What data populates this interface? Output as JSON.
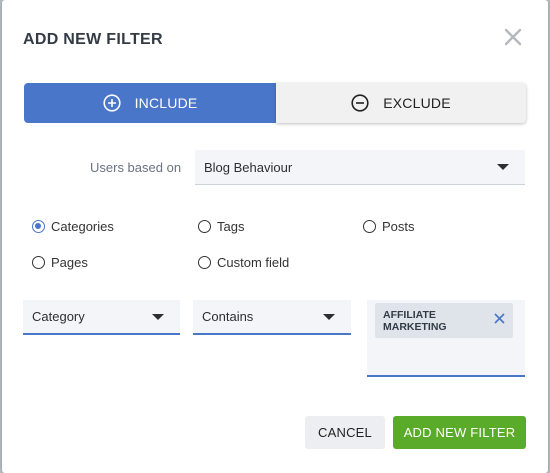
{
  "dialog": {
    "title": "ADD NEW FILTER"
  },
  "mode_toggle": {
    "include_label": "INCLUDE",
    "exclude_label": "EXCLUDE",
    "selected": "include",
    "accent_color": "#4a76c9"
  },
  "users_based_on": {
    "label": "Users based on",
    "value": "Blog Behaviour"
  },
  "filter_type": {
    "options": [
      "Categories",
      "Tags",
      "Posts",
      "Pages",
      "Custom field"
    ],
    "selected": "Categories"
  },
  "condition": {
    "field": "Category",
    "operator": "Contains",
    "values": [
      "AFFILIATE MARKETING"
    ]
  },
  "footer": {
    "cancel_label": "CANCEL",
    "add_label": "ADD NEW FILTER",
    "add_color": "#5bab2a"
  },
  "icons": {
    "close": "close-icon",
    "include": "plus-circle-icon",
    "exclude": "minus-circle-icon",
    "dropdown": "caret-down-icon",
    "remove_chip": "remove-icon"
  }
}
